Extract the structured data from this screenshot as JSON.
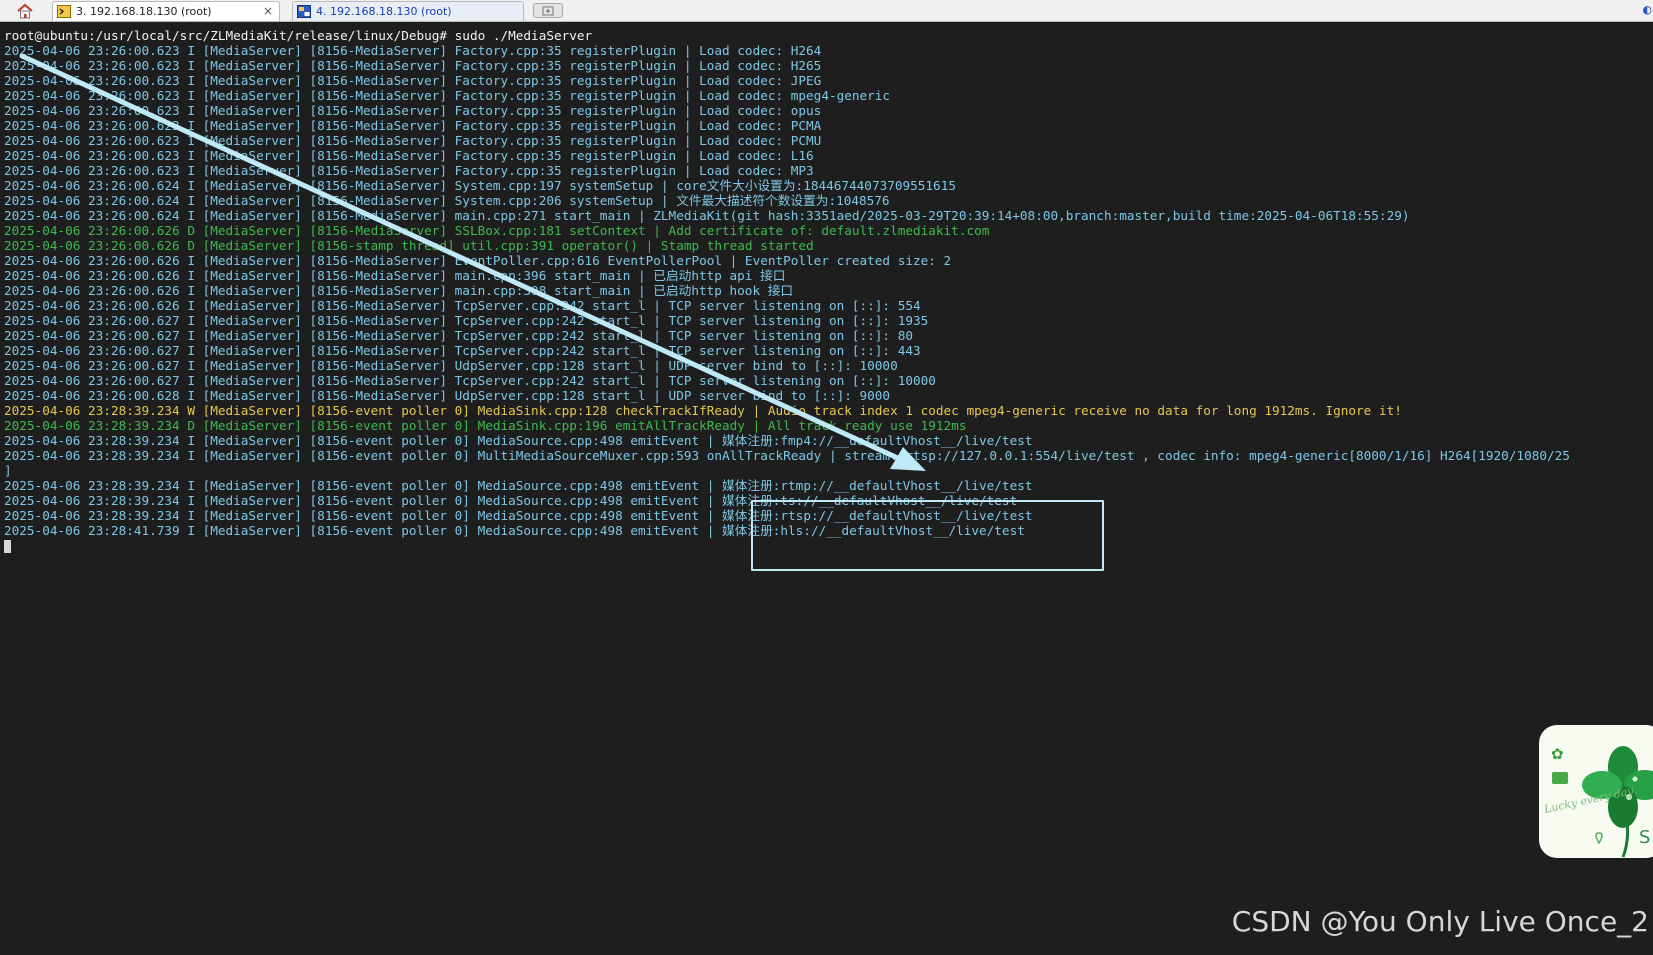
{
  "tabs": [
    {
      "label": "3. 192.168.18.130 (root)",
      "close": "×"
    },
    {
      "label": "4. 192.168.18.130 (root)"
    }
  ],
  "terminal": {
    "prompt": "root@ubuntu:/usr/local/src/ZLMediaKit/release/linux/Debug# sudo ./MediaServer",
    "lines": [
      {
        "text": "2025-04-06 23:26:00.623 I [MediaServer] [8156-MediaServer] Factory.cpp:35 registerPlugin | Load codec: H264",
        "level": "info"
      },
      {
        "text": "2025-04-06 23:26:00.623 I [MediaServer] [8156-MediaServer] Factory.cpp:35 registerPlugin | Load codec: H265",
        "level": "info"
      },
      {
        "text": "2025-04-06 23:26:00.623 I [MediaServer] [8156-MediaServer] Factory.cpp:35 registerPlugin | Load codec: JPEG",
        "level": "info"
      },
      {
        "text": "2025-04-06 23:26:00.623 I [MediaServer] [8156-MediaServer] Factory.cpp:35 registerPlugin | Load codec: mpeg4-generic",
        "level": "info"
      },
      {
        "text": "2025-04-06 23:26:00.623 I [MediaServer] [8156-MediaServer] Factory.cpp:35 registerPlugin | Load codec: opus",
        "level": "info"
      },
      {
        "text": "2025-04-06 23:26:00.623 I [MediaServer] [8156-MediaServer] Factory.cpp:35 registerPlugin | Load codec: PCMA",
        "level": "info"
      },
      {
        "text": "2025-04-06 23:26:00.623 I [MediaServer] [8156-MediaServer] Factory.cpp:35 registerPlugin | Load codec: PCMU",
        "level": "info"
      },
      {
        "text": "2025-04-06 23:26:00.623 I [MediaServer] [8156-MediaServer] Factory.cpp:35 registerPlugin | Load codec: L16",
        "level": "info"
      },
      {
        "text": "2025-04-06 23:26:00.623 I [MediaServer] [8156-MediaServer] Factory.cpp:35 registerPlugin | Load codec: MP3",
        "level": "info"
      },
      {
        "text": "2025-04-06 23:26:00.624 I [MediaServer] [8156-MediaServer] System.cpp:197 systemSetup | core文件大小设置为:18446744073709551615",
        "level": "info"
      },
      {
        "text": "2025-04-06 23:26:00.624 I [MediaServer] [8156-MediaServer] System.cpp:206 systemSetup | 文件最大描述符个数设置为:1048576",
        "level": "info"
      },
      {
        "text": "2025-04-06 23:26:00.624 I [MediaServer] [8156-MediaServer] main.cpp:271 start_main | ZLMediaKit(git hash:3351aed/2025-03-29T20:39:14+08:00,branch:master,build time:2025-04-06T18:55:29)",
        "level": "info"
      },
      {
        "text": "2025-04-06 23:26:00.626 D [MediaServer] [8156-MediaServer] SSLBox.cpp:181 setContext | Add certificate of: default.zlmediakit.com",
        "level": "debug"
      },
      {
        "text": "2025-04-06 23:26:00.626 D [MediaServer] [8156-stamp thread] util.cpp:391 operator() | Stamp thread started",
        "level": "debug"
      },
      {
        "text": "2025-04-06 23:26:00.626 I [MediaServer] [8156-MediaServer] EventPoller.cpp:616 EventPollerPool | EventPoller created size: 2",
        "level": "info"
      },
      {
        "text": "2025-04-06 23:26:00.626 I [MediaServer] [8156-MediaServer] main.cpp:396 start_main | 已启动http api 接口",
        "level": "info"
      },
      {
        "text": "2025-04-06 23:26:00.626 I [MediaServer] [8156-MediaServer] main.cpp:398 start_main | 已启动http hook 接口",
        "level": "info"
      },
      {
        "text": "2025-04-06 23:26:00.626 I [MediaServer] [8156-MediaServer] TcpServer.cpp:242 start_l | TCP server listening on [::]: 554",
        "level": "info"
      },
      {
        "text": "2025-04-06 23:26:00.627 I [MediaServer] [8156-MediaServer] TcpServer.cpp:242 start_l | TCP server listening on [::]: 1935",
        "level": "info"
      },
      {
        "text": "2025-04-06 23:26:00.627 I [MediaServer] [8156-MediaServer] TcpServer.cpp:242 start_l | TCP server listening on [::]: 80",
        "level": "info"
      },
      {
        "text": "2025-04-06 23:26:00.627 I [MediaServer] [8156-MediaServer] TcpServer.cpp:242 start_l | TCP server listening on [::]: 443",
        "level": "info"
      },
      {
        "text": "2025-04-06 23:26:00.627 I [MediaServer] [8156-MediaServer] UdpServer.cpp:128 start_l | UDP server bind to [::]: 10000",
        "level": "info"
      },
      {
        "text": "2025-04-06 23:26:00.627 I [MediaServer] [8156-MediaServer] TcpServer.cpp:242 start_l | TCP server listening on [::]: 10000",
        "level": "info"
      },
      {
        "text": "2025-04-06 23:26:00.628 I [MediaServer] [8156-MediaServer] UdpServer.cpp:128 start_l | UDP server bind to [::]: 9000",
        "level": "info"
      },
      {
        "text": "2025-04-06 23:28:39.234 W [MediaServer] [8156-event poller 0] MediaSink.cpp:128 checkTrackIfReady | Audio track index 1 codec mpeg4-generic receive no data for long 1912ms. Ignore it!",
        "level": "warn"
      },
      {
        "text": "2025-04-06 23:28:39.234 D [MediaServer] [8156-event poller 0] MediaSink.cpp:196 emitAllTrackReady | All track ready use 1912ms",
        "level": "debug"
      },
      {
        "text": "2025-04-06 23:28:39.234 I [MediaServer] [8156-event poller 0] MediaSource.cpp:498 emitEvent | 媒体注册:fmp4://__defaultVhost__/live/test",
        "level": "info"
      },
      {
        "text": "2025-04-06 23:28:39.234 I [MediaServer] [8156-event poller 0] MultiMediaSourceMuxer.cpp:593 onAllTrackReady | stream: rtsp://127.0.0.1:554/live/test , codec info: mpeg4-generic[8000/1/16] H264[1920/1080/25",
        "level": "info"
      },
      {
        "text": "]",
        "level": "info"
      },
      {
        "text": "2025-04-06 23:28:39.234 I [MediaServer] [8156-event poller 0] MediaSource.cpp:498 emitEvent | 媒体注册:rtmp://__defaultVhost__/live/test",
        "level": "info"
      },
      {
        "text": "2025-04-06 23:28:39.234 I [MediaServer] [8156-event poller 0] MediaSource.cpp:498 emitEvent | 媒体注册:ts://__defaultVhost__/live/test",
        "level": "info"
      },
      {
        "text": "2025-04-06 23:28:39.234 I [MediaServer] [8156-event poller 0] MediaSource.cpp:498 emitEvent | 媒体注册:rtsp://__defaultVhost__/live/test",
        "level": "info"
      },
      {
        "text": "2025-04-06 23:28:41.739 I [MediaServer] [8156-event poller 0] MediaSource.cpp:498 emitEvent | 媒体注册:hls://__defaultVhost__/live/test",
        "level": "info"
      }
    ]
  },
  "sticker": {
    "caption": "Lucky every day"
  },
  "watermark": "CSDN @You Only Live Once_2",
  "colors": {
    "background": "#1e1e1e",
    "info": "#7fc7e6",
    "debug": "#3fb950",
    "warn": "#e6c84f",
    "prompt": "#f3f3f3",
    "annotation": "#bfe9f6"
  },
  "icons": [
    "home-icon",
    "terminal-icon",
    "session-icon",
    "new-tab-icon",
    "clover-icon"
  ]
}
